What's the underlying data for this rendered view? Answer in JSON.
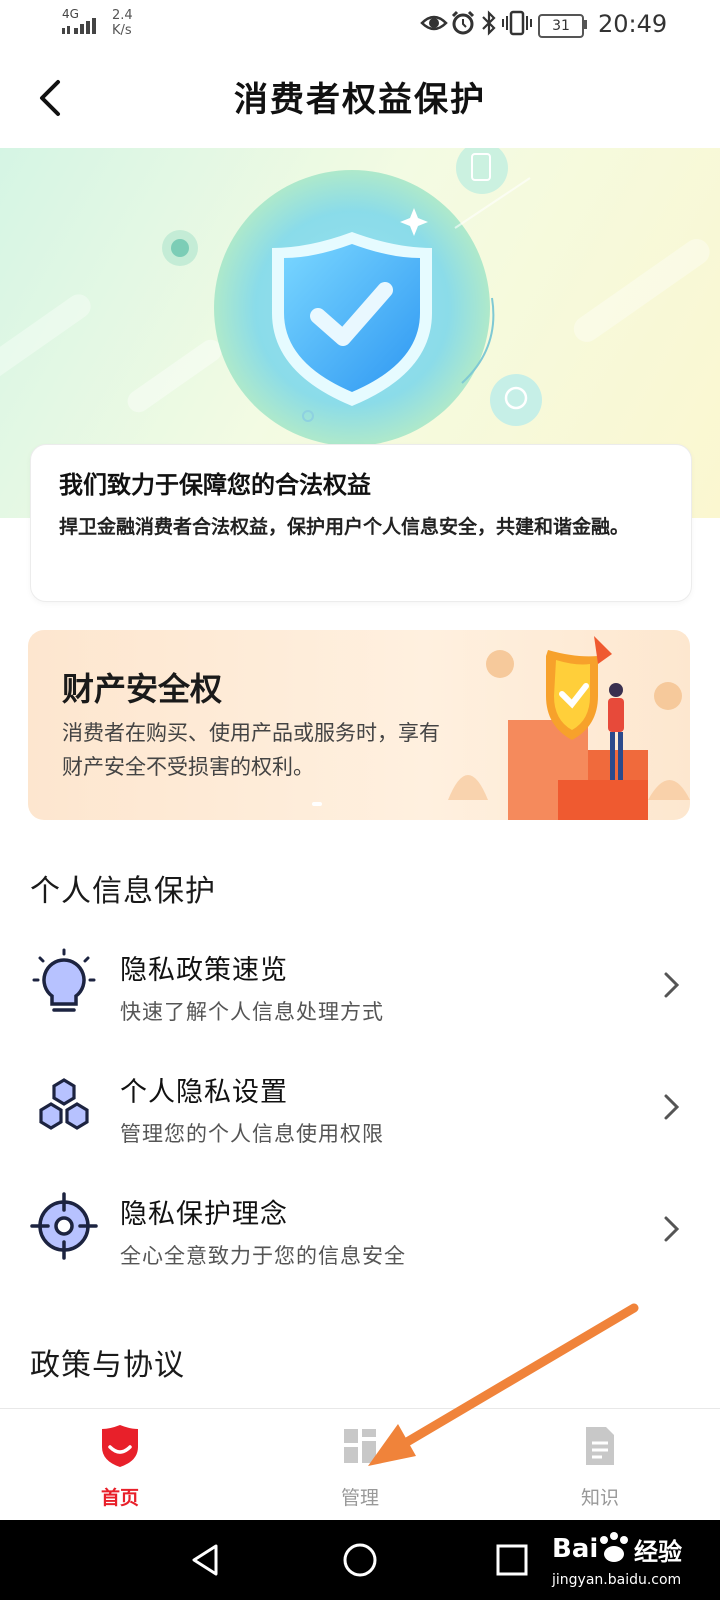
{
  "status_bar": {
    "network": "4G",
    "speed": "2.4",
    "speed_unit": "K/s",
    "battery": "31",
    "time": "20:49"
  },
  "header": {
    "title": "消费者权益保护"
  },
  "statement": {
    "heading": "我们致力于保障您的合法权益",
    "body": "捍卫金融消费者合法权益，保护用户个人信息安全，共建和谐金融。"
  },
  "rights_card": {
    "title": "财产安全权",
    "body": "消费者在购买、使用产品或服务时，享有财产安全不受损害的权利。"
  },
  "personal_info": {
    "title": "个人信息保护",
    "items": [
      {
        "label": "隐私政策速览",
        "sub": "快速了解个人信息处理方式",
        "icon": "lightbulb-icon"
      },
      {
        "label": "个人隐私设置",
        "sub": "管理您的个人信息使用权限",
        "icon": "hexagons-icon"
      },
      {
        "label": "隐私保护理念",
        "sub": "全心全意致力于您的信息安全",
        "icon": "target-icon"
      }
    ]
  },
  "policy": {
    "title": "政策与协议"
  },
  "tabs": [
    {
      "label": "首页",
      "active": true,
      "icon": "shield-icon"
    },
    {
      "label": "管理",
      "active": false,
      "icon": "grid-icon"
    },
    {
      "label": "知识",
      "active": false,
      "icon": "document-icon"
    }
  ],
  "watermark": {
    "brand": "Bai",
    "brand2": "经验",
    "url": "jingyan.baidu.com"
  },
  "colors": {
    "accent": "#e8202a",
    "icon_fill": "#b7c2ff",
    "icon_stroke": "#1c2340",
    "inactive": "#999999",
    "annotation_arrow": "#f0833a"
  }
}
